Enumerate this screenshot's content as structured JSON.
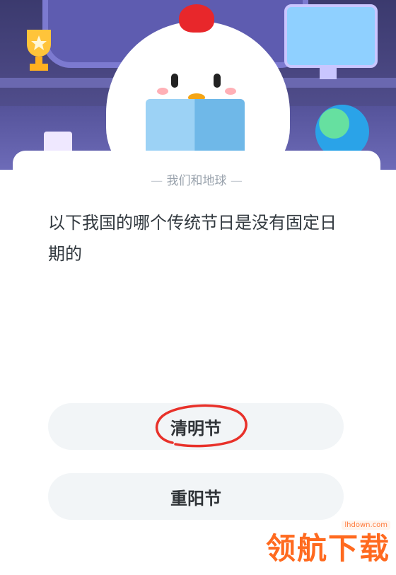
{
  "topic": "我们和地球",
  "question": "以下我国的哪个传统节日是没有固定日期的",
  "options": [
    {
      "label": "清明节"
    },
    {
      "label": "重阳节"
    }
  ],
  "colors": {
    "accent_mark": "#e8312a",
    "option_bg": "#f2f5f7",
    "watermark": "#ff6a1f"
  },
  "watermark": {
    "url": "lhdown.com",
    "text": "领航下载"
  }
}
